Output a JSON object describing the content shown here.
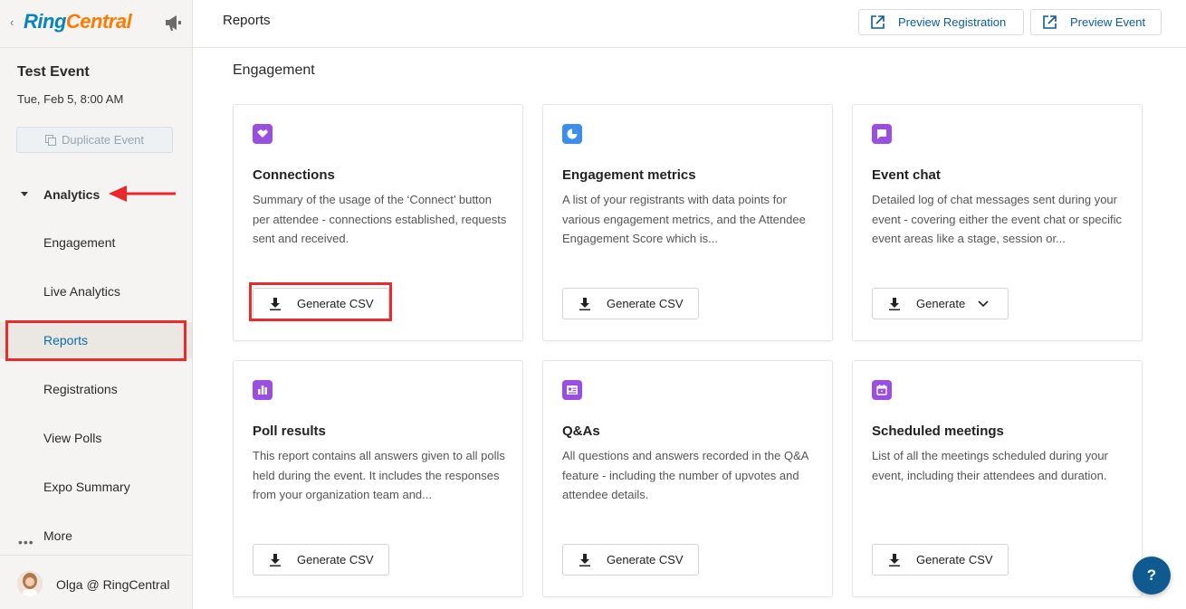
{
  "app": {
    "logo_ring": "Ring",
    "logo_central": "Central",
    "back_chevron": "‹"
  },
  "event": {
    "title": "Test Event",
    "date": "Tue, Feb 5, 8:00 AM",
    "duplicate_label": "Duplicate Event"
  },
  "sidebar": {
    "section_label": "Analytics",
    "items": [
      {
        "label": "Engagement",
        "active": false
      },
      {
        "label": "Live Analytics",
        "active": false
      },
      {
        "label": "Reports",
        "active": true
      },
      {
        "label": "Registrations",
        "active": false
      },
      {
        "label": "View Polls",
        "active": false
      },
      {
        "label": "Expo Summary",
        "active": false
      }
    ],
    "more_label": "More",
    "more_dots": "•••",
    "user_name": "Olga @ RingCentral"
  },
  "header": {
    "title": "Reports",
    "preview_registration": "Preview Registration",
    "preview_event": "Preview Event"
  },
  "main": {
    "section_title": "Engagement",
    "cards": [
      {
        "title": "Connections",
        "desc": "Summary of the usage of the ‘Connect’ button per attendee - connections established, requests sent and received.",
        "button": "Generate CSV",
        "icon": "handshake-icon",
        "icon_color": "#9b4fe0"
      },
      {
        "title": "Engagement metrics",
        "desc": "A list of your registrants with data points for various engagement metrics, and the Attendee Engagement Score which is...",
        "button": "Generate CSV",
        "icon": "pie-chart-icon",
        "icon_color": "#3b8ef0"
      },
      {
        "title": "Event chat",
        "desc": "Detailed log of chat messages sent during your event - covering either the event chat or specific event areas like a stage, session or...",
        "button": "Generate",
        "icon": "chat-icon",
        "icon_color": "#9b4fe0"
      },
      {
        "title": "Poll results",
        "desc": "This report contains all answers given to all polls held during the event. It includes the responses from your organization team and...",
        "button": "Generate CSV",
        "icon": "bar-chart-icon",
        "icon_color": "#9b4fe0"
      },
      {
        "title": "Q&As",
        "desc": "All questions and answers recorded in the Q&A feature - including the number of upvotes and attendee details.",
        "button": "Generate CSV",
        "icon": "qa-icon",
        "icon_color": "#9b4fe0"
      },
      {
        "title": "Scheduled meetings",
        "desc": "List of all the meetings scheduled during your event, including their attendees and duration.",
        "button": "Generate CSV",
        "icon": "calendar-icon",
        "icon_color": "#9b4fe0"
      }
    ]
  },
  "help_label": "?"
}
